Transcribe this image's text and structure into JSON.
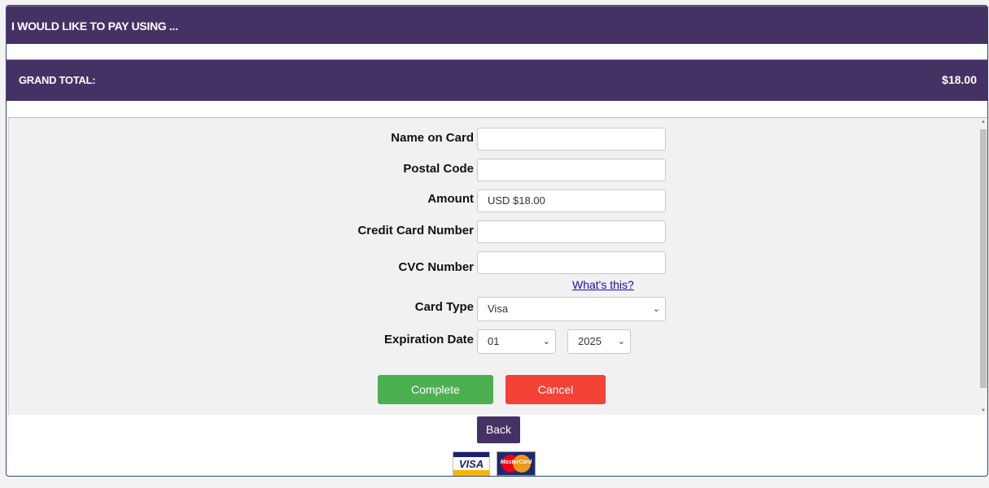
{
  "header": {
    "pay_title": "I WOULD LIKE TO PAY USING ...",
    "grand_total_label": "GRAND TOTAL:",
    "grand_total_value": "$18.00"
  },
  "form": {
    "name_label": "Name on Card",
    "name_value": "",
    "postal_label": "Postal Code",
    "postal_value": "",
    "amount_label": "Amount",
    "amount_value": "USD $18.00",
    "cc_label": "Credit Card Number",
    "cc_value": "",
    "cvc_label": "CVC Number",
    "cvc_value": "",
    "whats_this": "What's this?",
    "card_type_label": "Card Type",
    "card_type_value": "Visa",
    "expiration_label": "Expiration Date",
    "exp_month": "01",
    "exp_year": "2025",
    "complete_label": "Complete",
    "cancel_label": "Cancel"
  },
  "footer": {
    "back_label": "Back",
    "visa_text": "VISA",
    "mastercard_text": "MasterCard"
  },
  "colors": {
    "header_bg": "#453264",
    "complete_bg": "#4caf50",
    "cancel_bg": "#f44336",
    "link": "#1a0dab"
  }
}
